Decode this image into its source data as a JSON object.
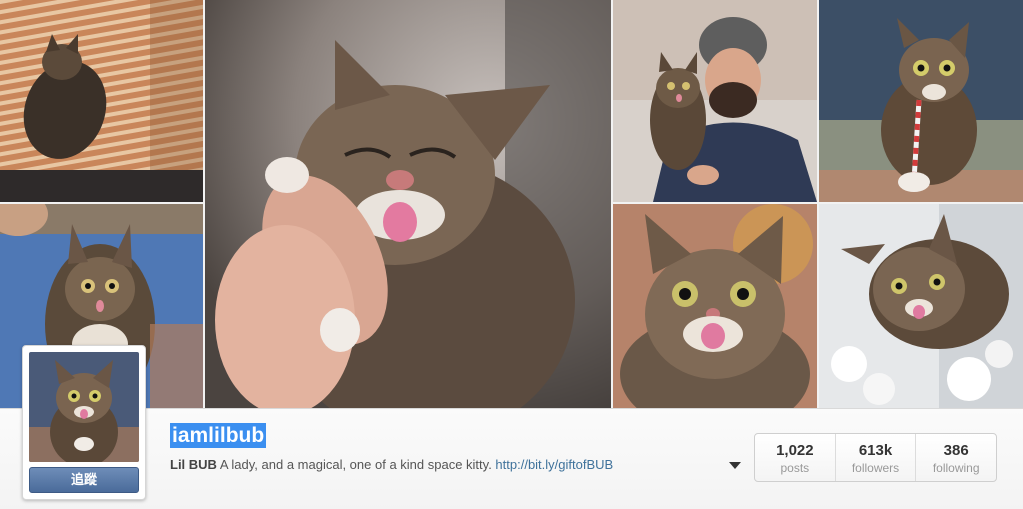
{
  "profile": {
    "username": "iamlilbub",
    "follow_label": "追蹤",
    "bio_name": "Lil BUB",
    "bio_text": " A lady, and a magical, one of a kind space kitty. ",
    "bio_link": "http://bit.ly/giftofBUB"
  },
  "stats": [
    {
      "value": "1,022",
      "label": "posts"
    },
    {
      "value": "613k",
      "label": "followers"
    },
    {
      "value": "386",
      "label": "following"
    }
  ],
  "colors": {
    "follow_button": "#4a6b9a",
    "username_highlight": "#3b8ff0",
    "link": "#3f729b"
  },
  "icons": {
    "dropdown": "chevron-down-icon"
  }
}
